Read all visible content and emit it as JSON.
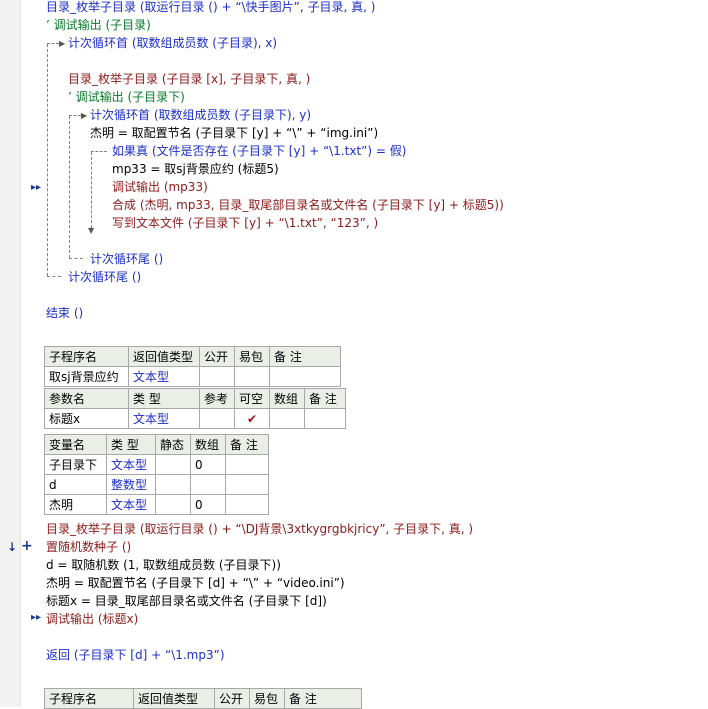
{
  "lines": {
    "l1": "目录_枚举子目录 (取运行目录 () + “\\快手图片”, 子目录, 真, )",
    "l2": "’ 调试输出 (子目录)",
    "l3": "计次循环首 (取数组成员数 (子目录), x)",
    "l4": "目录_枚举子目录 (子目录 [x], 子目录下, 真, )",
    "l5": "’ 调试输出 (子目录下)",
    "l6": "计次循环首 (取数组成员数 (子目录下), y)",
    "l7": "杰明 = 取配置节名 (子目录下 [y] + “\\” + “img.ini”)",
    "l8": "如果真 (文件是否存在 (子目录下 [y] + “\\1.txt”) = 假)",
    "l9": "mp33 = 取sj背景应约 (标题5)",
    "l10": "调试输出 (mp33)",
    "l11": "合成 (杰明, mp33, 目录_取尾部目录名或文件名 (子目录下 [y] + 标题5))",
    "l12": "写到文本文件 (子目录下 [y] + “\\1.txt”, “123”, )",
    "l13": "计次循环尾 ()",
    "l14": "计次循环尾 ()",
    "l15": "结束 ()",
    "l16": "目录_枚举子目录 (取运行目录 () + “\\DJ背景\\3xtkygrgbkjricy”, 子目录下, 真, )",
    "l17": "置随机数种子 ()",
    "l18": "d = 取随机数 (1, 取数组成员数 (子目录下))",
    "l19": "杰明 = 取配置节名 (子目录下 [d] + “\\” + “video.ini”)",
    "l20": "标题x = 目录_取尾部目录名或文件名 (子目录下 [d])",
    "l21": "调试输出 (标题x)",
    "l22": "返回 (子目录下 [d] + “\\1.mp3”)"
  },
  "markers": {
    "arrow1": "▸▸",
    "arrow2": "▸▸",
    "down": "↓",
    "plus": "+"
  },
  "table1": {
    "header": [
      "子程序名",
      "返回值类型",
      "公开",
      "易包",
      "备 注"
    ],
    "row": [
      "取sj背景应约",
      "文本型",
      "",
      "",
      ""
    ],
    "param_header": [
      "参数名",
      "类 型",
      "参考",
      "可空",
      "数组",
      "备 注"
    ],
    "param_row": [
      "标题x",
      "文本型",
      "",
      "✔",
      "",
      ""
    ]
  },
  "table2": {
    "header": [
      "变量名",
      "类 型",
      "静态",
      "数组",
      "备 注"
    ],
    "rows": [
      [
        "子目录下",
        "文本型",
        "",
        "0",
        ""
      ],
      [
        "d",
        "整数型",
        "",
        "",
        ""
      ],
      [
        "杰明",
        "文本型",
        "",
        "0",
        ""
      ]
    ]
  },
  "table3": {
    "header": [
      "子程序名",
      "返回值类型",
      "公开",
      "易包",
      "备 注"
    ]
  }
}
